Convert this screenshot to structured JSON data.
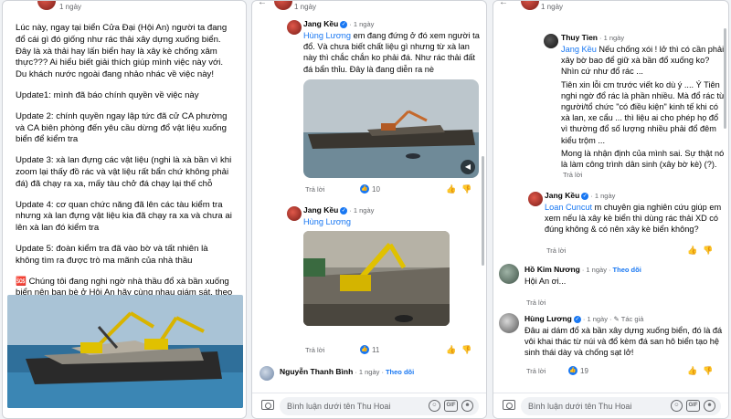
{
  "panel1": {
    "time": "1 ngày",
    "paragraphs": [
      "Lúc này, ngay tại biển Cửa Đại (Hội An) người ta đang đổ cái gì đó giống như rác thải xây dựng xuống biển. Đây là xà thải hay lấn biển hay là xây kè chống xâm thực??? Ai hiểu biết giải thích giúp mình việc này với. Du khách nước ngoài đang nhảo nhác về việc này!",
      "Update1: mình đã báo chính quyền về việc này",
      "Update 2: chính quyền ngay lập tức đã cử CA phường và CA biên phòng đến yêu cầu dừng đổ vật liệu xuống biển để kiểm tra",
      "Update 3: xà lan đựng các vật liệu (nghi là xà bần vì khi zoom lại thấy đồ rác và vật liệu rất bẩn chứ không phải đá) đã chạy ra xa, mấy tàu chở đá chạy lại thế chỗ",
      "Update 4: cơ quan chức năng đã lên các tàu kiểm tra nhưng xà lan đựng vật liệu kia đã chạy ra xa và chưa ai lên xà lan đó kiểm tra",
      "Update 5: đoàn kiểm tra đã vào bờ và tất nhiên là không tìm ra được trò ma mãnh của nhà thầu",
      "🆘 Chúng tôi đang nghi ngờ nhà thầu đổ xà bần xuống biển nên bạn bè ở Hội An hãy cùng nhau giám sát, theo dõi để không ai có thể phá hoại biển, phá hoại môi trường và cuộc sống của chúng ta được!"
    ]
  },
  "panel2": {
    "time": "1 ngày",
    "comment1": {
      "name": "Jang Kều",
      "meta": "· 1 ngày",
      "mention": "Hùng Lương",
      "text": " em đang đứng ở đó xem người ta đổ. Và chưa biết chất liệu gì nhưng từ xà lan này thì chắc chắn ko phải đá. Như rác thải đất đá bẩn thỉu. Đây là đang diễn ra nè",
      "reply": "Trả lời",
      "reactions": "10"
    },
    "comment2": {
      "name": "Jang Kều",
      "meta": "· 1 ngày",
      "mention": "Hùng Lương",
      "reply": "Trả lời",
      "reactions": "11"
    },
    "comment3": {
      "name": "Nguyễn Thanh Bình",
      "meta": "· 1 ngày ·",
      "follow": "Theo dõi"
    },
    "composer_placeholder": "Bình luận dưới tên Thu Hoai"
  },
  "panel3": {
    "time": "1 ngày",
    "comment1": {
      "name": "Thuy Tien",
      "meta": "· 1 ngày",
      "mention": "Jang Kều",
      "text_a": " Nếu chống xói ! lở thì có cần phải xây bờ bao để giữ xà bần đổ xuống ko? Nhìn cứ như đổ rác ...",
      "text_b": "Tiên xin lỗi cm trước viết ko dù ý .... Ý Tiên nghi ngờ đổ rác là phần nhiều. Mà đổ rác từ người/tổ chức \"có điều kiện\" kinh tế khi có xà lan, xe cẩu ... thì liệu ai cho phép họ đổ vì thường đổ số lượng nhiều phải đổ đêm kiểu trộm ...",
      "text_c": "Mong là nhận định của mình sai. Sự thật nó là làm công trình dân sinh (xây bờ kè) (?).",
      "reply": "Trả lời"
    },
    "comment2": {
      "name": "Jang Kều",
      "meta": "· 1 ngày",
      "mention": "Loan Cuncut",
      "text": " m chuyên gia nghiên cứu giúp em xem nếu là xây kè biển thì dùng rác thải XD có đúng không & có nên xây kè biển không?",
      "reply": "Trả lời"
    },
    "comment3": {
      "name": "Hồ Kim Nương",
      "meta": "· 1 ngày ·",
      "follow": "Theo dõi",
      "text": "Hội An ơi...",
      "reply": "Trả lời"
    },
    "comment4": {
      "name": "Hùng Lương",
      "meta": "· 1 ngày ·",
      "author_tag": "Tác giả",
      "text": "Đâu ai dám đổ xà bần xây dựng xuống biển, đó là đá vôi khai thác từ núi và đổ kèm đá san hô biển tạo hệ sinh thái dày và chống sạt lở!",
      "reply": "Trả lời",
      "reactions": "19"
    },
    "composer_placeholder": "Bình luận dưới tên Thu Hoai"
  },
  "icons": {
    "camera": "camera-icon",
    "emoji": "emoji-icon",
    "gif": "gif-icon",
    "sticker": "sticker-icon",
    "like": "like-icon",
    "dislike": "dislike-icon",
    "verified": "verified-icon"
  },
  "colors": {
    "link": "#1877f2",
    "muted": "#65676b",
    "bg": "#f0f2f5"
  }
}
